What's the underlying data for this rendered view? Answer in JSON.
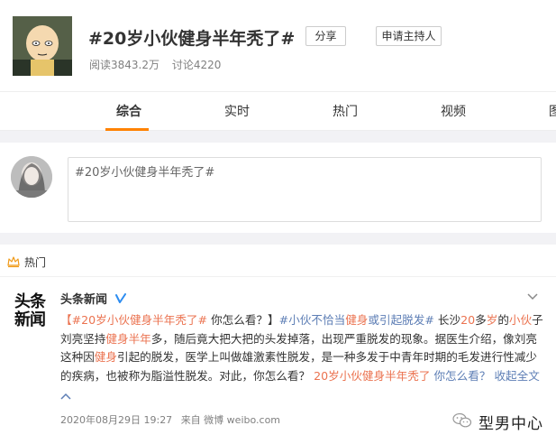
{
  "topic": {
    "title": "#20岁小伙健身半年秃了#",
    "share_label": "分享",
    "host_label": "申请主持人",
    "reads": "阅读3843.2万",
    "discussions": "讨论4220"
  },
  "tabs": [
    {
      "label": "综合",
      "active": true
    },
    {
      "label": "实时",
      "active": false
    },
    {
      "label": "热门",
      "active": false
    },
    {
      "label": "视频",
      "active": false
    },
    {
      "label": "图",
      "active": false
    }
  ],
  "composer": {
    "text": "#20岁小伙健身半年秃了#"
  },
  "hot_section": {
    "label": "热门"
  },
  "post": {
    "author": "头条新闻",
    "logo_line1": "头条",
    "logo_line2": "新闻",
    "body": {
      "p01": "【",
      "p02": "#20岁小伙健身半年秃了#",
      "p03": " 你怎么看？】",
      "p04": "#小伙不恰当",
      "p05": "健身",
      "p06": "或引起脱发#",
      "p07": " 长沙",
      "p08": "20",
      "p09": "多",
      "p10": "岁",
      "p11": "的",
      "p12": "小伙",
      "p13": "子刘亮坚持",
      "p14": "健身半年",
      "p15": "多，随后竟大把大把的头发掉落，出现严重脱发的现象。据医生介绍，像刘亮这种因",
      "p16": "健身",
      "p17": "引起的脱发，医学上叫做雄激素性脱发，是一种多发于中青年时期的毛发进行性减少的疾病，也被称为脂溢性脱发。对此，你怎么看？ ",
      "p18": "20岁小伙健身半年秃了",
      "p19": " 你怎么看？ ",
      "p20": "收起全文"
    },
    "collapse_icon": "chevron-up",
    "date": "2020年08月29日 19:27",
    "source": "来自 微博 weibo.com"
  },
  "watermark": {
    "text": "型男中心"
  },
  "colors": {
    "accent_orange": "#ff8200",
    "highlight": "#eb7350",
    "link_blue": "#5d7eb5",
    "verified": "#2d8cf0"
  }
}
